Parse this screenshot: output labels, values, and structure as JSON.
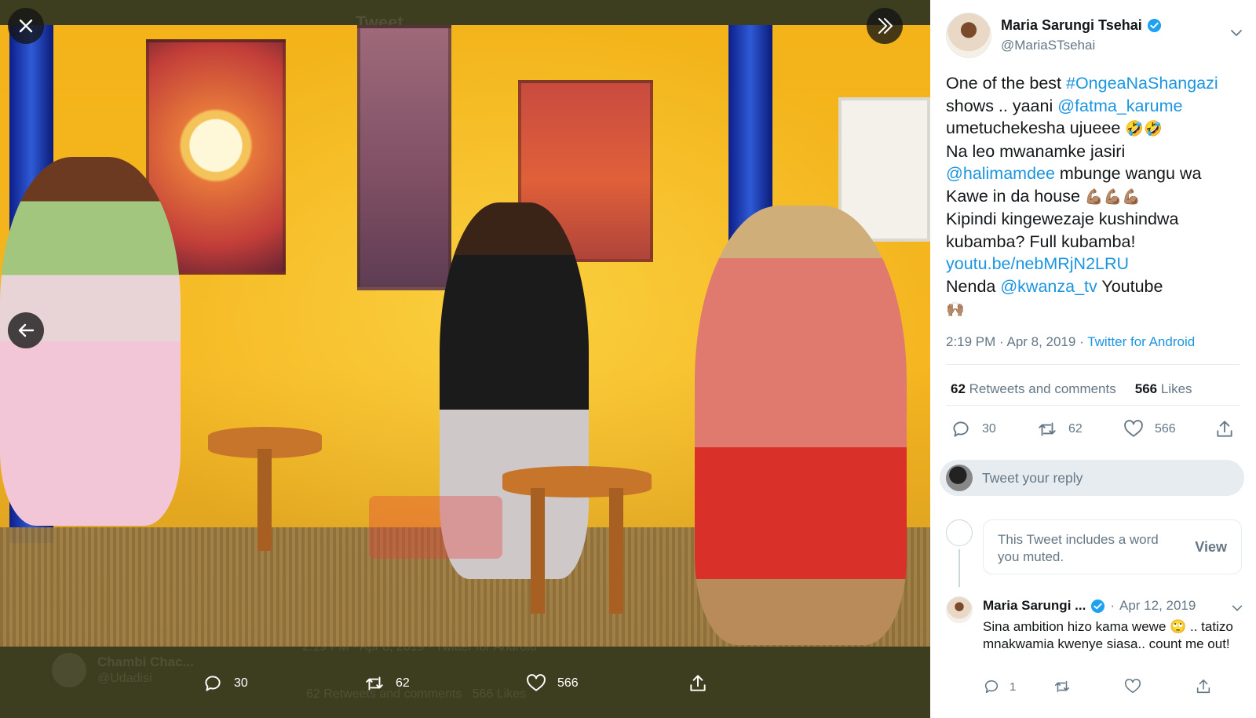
{
  "background_ghost": {
    "header_title": "Tweet",
    "author_name": "Chambi Chac...",
    "author_handle": "@Udadisi",
    "timestamp": "2:19 PM · Apr 8, 2019 · Twitter for Android",
    "counts": "62 Retweets and comments   566 Likes"
  },
  "media": {
    "close_label": "close",
    "expand_label": "expand",
    "back_label": "previous"
  },
  "media_actions": {
    "replies": "30",
    "retweets": "62",
    "likes": "566"
  },
  "tweet": {
    "author_name": "Maria Sarungi Tsehai",
    "author_handle": "@MariaSTsehai",
    "lines": [
      {
        "parts": [
          {
            "text": "One of the best ",
            "link": false
          },
          {
            "text": "#OngeaNaShangazi",
            "link": true
          }
        ]
      },
      {
        "parts": [
          {
            "text": "shows .. yaani ",
            "link": false
          },
          {
            "text": "@fatma_karume",
            "link": true
          }
        ]
      },
      {
        "parts": [
          {
            "text": "umetuchekesha ujueee ",
            "link": false
          },
          {
            "text": "🤣🤣",
            "link": false,
            "emoji": true
          }
        ]
      },
      {
        "parts": [
          {
            "text": "Na leo mwanamke jasiri",
            "link": false
          }
        ]
      },
      {
        "parts": [
          {
            "text": "@halimamdee",
            "link": true
          },
          {
            "text": " mbunge wangu wa",
            "link": false
          }
        ]
      },
      {
        "parts": [
          {
            "text": "Kawe in da house ",
            "link": false
          },
          {
            "text": "💪🏽💪🏽💪🏽",
            "link": false,
            "emoji": true
          }
        ]
      },
      {
        "parts": [
          {
            "text": "Kipindi kingewezaje kushindwa",
            "link": false
          }
        ]
      },
      {
        "parts": [
          {
            "text": "kubamba? Full kubamba!",
            "link": false
          }
        ]
      },
      {
        "parts": [
          {
            "text": "youtu.be/nebMRjN2LRU",
            "link": true
          }
        ]
      },
      {
        "parts": [
          {
            "text": "Nenda ",
            "link": false
          },
          {
            "text": "@kwanza_tv",
            "link": true
          },
          {
            "text": " Youtube",
            "link": false
          }
        ]
      },
      {
        "parts": [
          {
            "text": "🙌🏽",
            "link": false,
            "emoji": true
          }
        ]
      }
    ],
    "time": "2:19 PM · Apr 8, 2019 · ",
    "source": "Twitter for Android",
    "retweet_count": "62",
    "retweet_label": "Retweets and comments",
    "like_count": "566",
    "like_label": "Likes",
    "action_replies": "30",
    "action_retweets": "62",
    "action_likes": "566"
  },
  "reply_box": {
    "placeholder": "Tweet your reply"
  },
  "muted_notice": {
    "text": "This Tweet includes a word you muted.",
    "view_label": "View"
  },
  "reply_tweet": {
    "author_name": "Maria Sarungi ...",
    "separator": "·",
    "date": "Apr 12, 2019",
    "text": "Sina ambition hizo kama wewe 🙄 .. tatizo mnakwamia kwenye siasa.. count me out!",
    "replies": "1"
  },
  "colors": {
    "link": "#1b95e0",
    "verified": "#1da1f2",
    "secondary_text": "#657786",
    "overlay_bg": "#3e3f22"
  },
  "icons": [
    "close-icon",
    "expand-icon",
    "back-arrow-icon",
    "reply-icon",
    "retweet-icon",
    "like-icon",
    "share-icon",
    "verified-icon",
    "chevron-down-icon"
  ]
}
